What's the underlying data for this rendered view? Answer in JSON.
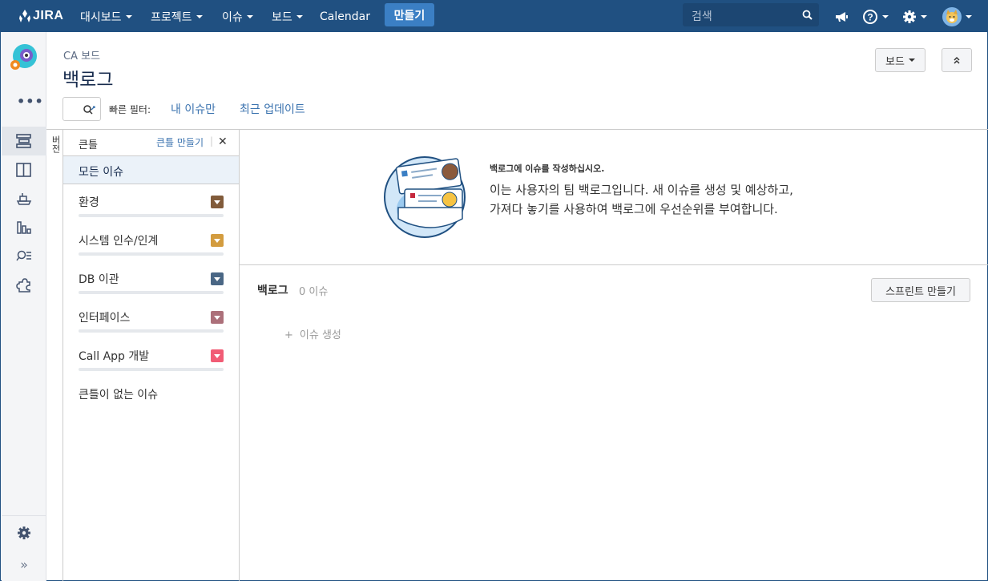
{
  "topbar": {
    "logo_text": "JIRA",
    "nav": [
      "대시보드",
      "프로젝트",
      "이슈",
      "보드",
      "Calendar"
    ],
    "create_label": "만들기",
    "search_placeholder": "검색"
  },
  "header": {
    "breadcrumb": "CA 보드",
    "title": "백로그",
    "board_button": "보드"
  },
  "quick_filters": {
    "label": "빠른 필터:",
    "items": [
      "내 이슈만",
      "최근 업데이트"
    ]
  },
  "versions_tab": "버전",
  "epics": {
    "heading": "큰틀",
    "create_link": "큰틀 만들기",
    "all_issues": "모든 이슈",
    "items": [
      {
        "name": "환경",
        "color": "#815b3a"
      },
      {
        "name": "시스템 인수/인계",
        "color": "#d39c3f"
      },
      {
        "name": "DB 이관",
        "color": "#4a6785"
      },
      {
        "name": "인터페이스",
        "color": "#ac707a"
      },
      {
        "name": "Call App 개발",
        "color": "#f15c75"
      }
    ],
    "no_epic": "큰틀이 없는 이슈"
  },
  "empty_state": {
    "title": "백로그에 이슈를 작성하십시오.",
    "line1": "이는 사용자의 팀 백로그입니다. 새 이슈를 생성 및 예상하고,",
    "line2": "가져다 놓기를 사용하여 백로그에 우선순위를 부여합니다."
  },
  "backlog": {
    "title": "백로그",
    "count": "0 이슈",
    "create_sprint": "스프린트 만들기",
    "create_issue": "이슈 생성"
  },
  "sidebar_icons": [
    "backlog-icon",
    "board-icon",
    "releases-icon",
    "reports-icon",
    "issues-icon",
    "addons-icon",
    "settings-icon",
    "expand-icon"
  ]
}
